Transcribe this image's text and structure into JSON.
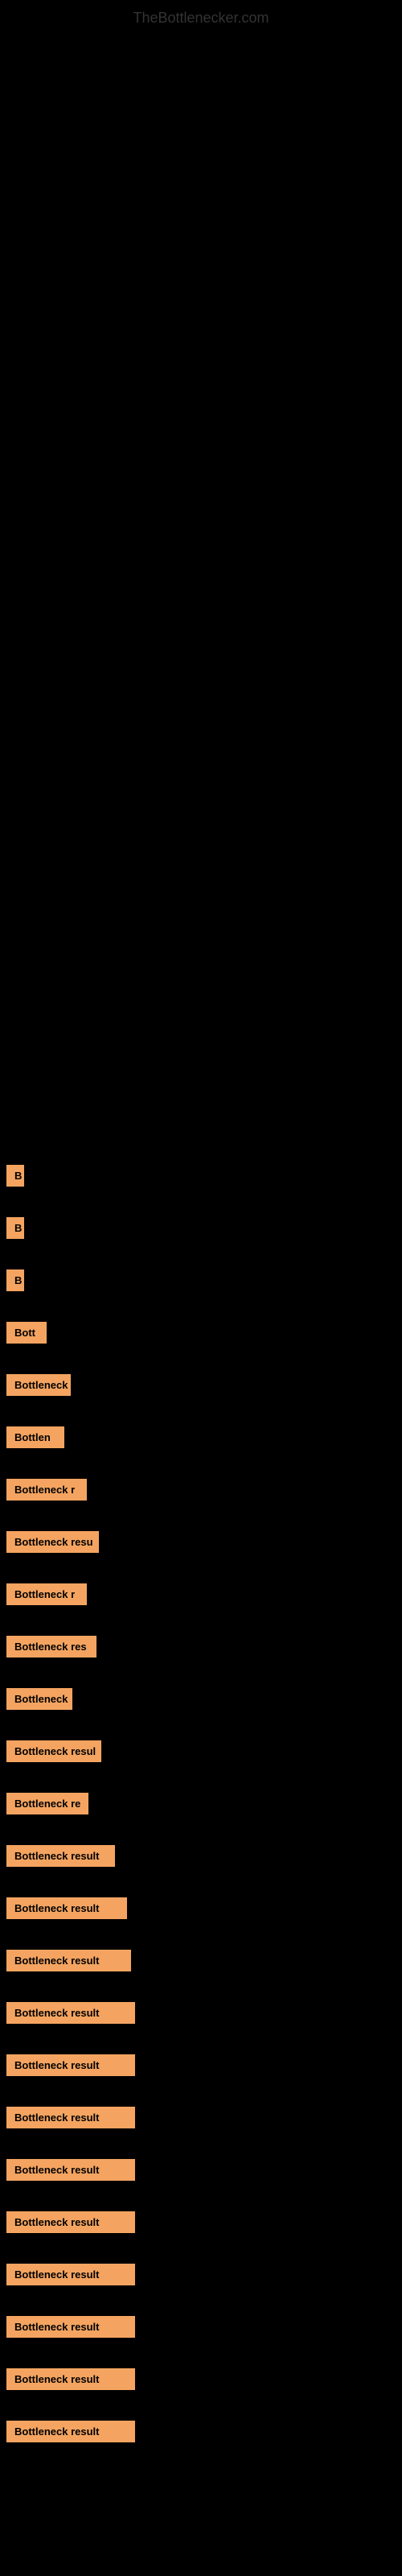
{
  "site": {
    "title": "TheBottlenecker.com"
  },
  "results": [
    {
      "id": 1,
      "label": "B",
      "width_class": "label-w1"
    },
    {
      "id": 2,
      "label": "B",
      "width_class": "label-w2"
    },
    {
      "id": 3,
      "label": "B",
      "width_class": "label-w3"
    },
    {
      "id": 4,
      "label": "Bott",
      "width_class": "label-w4"
    },
    {
      "id": 5,
      "label": "Bottleneck",
      "width_class": "label-w5"
    },
    {
      "id": 6,
      "label": "Bottlen",
      "width_class": "label-w6"
    },
    {
      "id": 7,
      "label": "Bottleneck r",
      "width_class": "label-w7"
    },
    {
      "id": 8,
      "label": "Bottleneck resu",
      "width_class": "label-w8"
    },
    {
      "id": 9,
      "label": "Bottleneck r",
      "width_class": "label-w9"
    },
    {
      "id": 10,
      "label": "Bottleneck res",
      "width_class": "label-w10"
    },
    {
      "id": 11,
      "label": "Bottleneck",
      "width_class": "label-w11"
    },
    {
      "id": 12,
      "label": "Bottleneck resul",
      "width_class": "label-w12"
    },
    {
      "id": 13,
      "label": "Bottleneck re",
      "width_class": "label-w13"
    },
    {
      "id": 14,
      "label": "Bottleneck result",
      "width_class": "label-w14"
    },
    {
      "id": 15,
      "label": "Bottleneck result",
      "width_class": "label-w15"
    },
    {
      "id": 16,
      "label": "Bottleneck result",
      "width_class": "label-w16"
    },
    {
      "id": 17,
      "label": "Bottleneck result",
      "width_class": "label-w17"
    },
    {
      "id": 18,
      "label": "Bottleneck result",
      "width_class": "label-w18"
    },
    {
      "id": 19,
      "label": "Bottleneck result",
      "width_class": "label-w19"
    },
    {
      "id": 20,
      "label": "Bottleneck result",
      "width_class": "label-w20"
    },
    {
      "id": 21,
      "label": "Bottleneck result",
      "width_class": "label-w21"
    },
    {
      "id": 22,
      "label": "Bottleneck result",
      "width_class": "label-w22"
    },
    {
      "id": 23,
      "label": "Bottleneck result",
      "width_class": "label-w23"
    },
    {
      "id": 24,
      "label": "Bottleneck result",
      "width_class": "label-w24"
    },
    {
      "id": 25,
      "label": "Bottleneck result",
      "width_class": "label-w25"
    }
  ]
}
